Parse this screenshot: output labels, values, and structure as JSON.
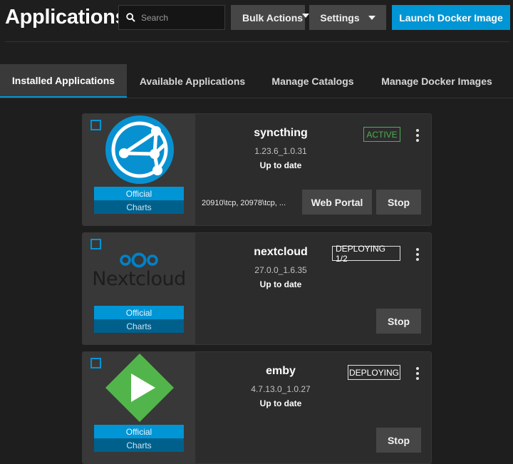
{
  "header": {
    "title": "Applications",
    "search_placeholder": "Search",
    "bulk_actions_label": "Bulk Actions",
    "settings_label": "Settings",
    "launch_label": "Launch Docker Image"
  },
  "tabs": [
    {
      "label": "Installed Applications",
      "active": true
    },
    {
      "label": "Available Applications",
      "active": false
    },
    {
      "label": "Manage Catalogs",
      "active": false
    },
    {
      "label": "Manage Docker Images",
      "active": false
    }
  ],
  "apps": [
    {
      "name": "syncthing",
      "version": "1.23.6_1.0.31",
      "update_status": "Up to date",
      "state": "ACTIVE",
      "badge_official": "Official",
      "badge_charts": "Charts",
      "ports": "20910\\tcp, 20978\\tcp, ...",
      "web_portal_label": "Web Portal",
      "stop_label": "Stop",
      "logo_icon": "syncthing-logo-icon"
    },
    {
      "name": "nextcloud",
      "version": "27.0.0_1.6.35",
      "update_status": "Up to date",
      "state": "DEPLOYING 1/2",
      "badge_official": "Official",
      "badge_charts": "Charts",
      "logo_text": "Nextcloud",
      "stop_label": "Stop",
      "logo_icon": "nextcloud-logo-icon"
    },
    {
      "name": "emby",
      "version": "4.7.13.0_1.0.27",
      "update_status": "Up to date",
      "state": "DEPLOYING",
      "badge_official": "Official",
      "badge_charts": "Charts",
      "stop_label": "Stop",
      "logo_icon": "emby-logo-icon"
    }
  ],
  "colors": {
    "accent": "#0095d5",
    "active_status": "#4caf50",
    "emby_green": "#52b54b"
  }
}
